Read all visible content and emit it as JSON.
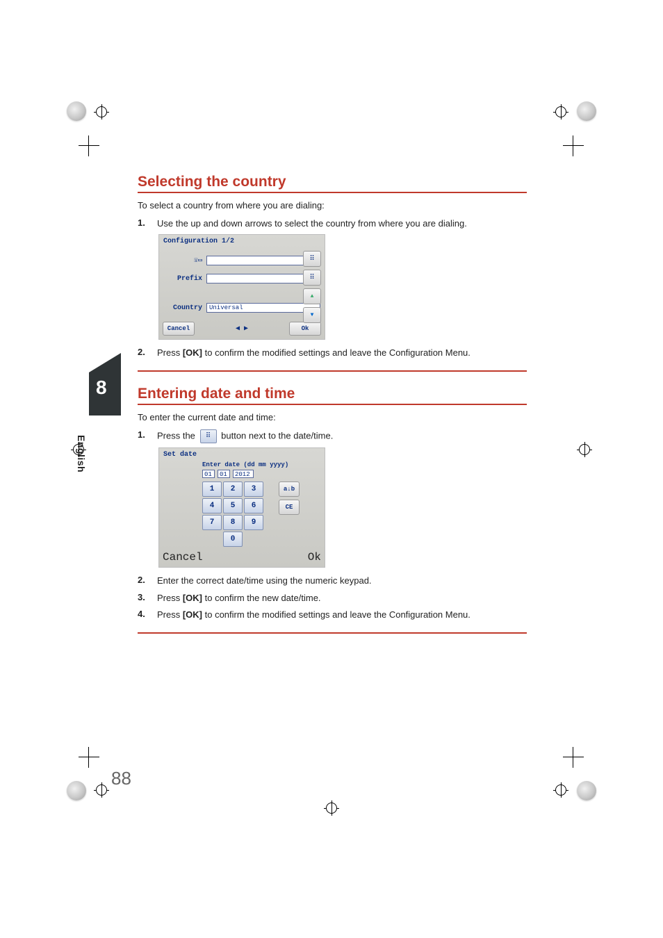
{
  "page_number": "88",
  "chapter_number": "8",
  "language_tab": "English",
  "section1": {
    "title": "Selecting the country",
    "intro": "To select a country from where you are dialing:",
    "steps": [
      {
        "num": "1.",
        "text": "Use the up and down arrows to select the country from where you are dialing."
      },
      {
        "num": "2.",
        "pre": "Press ",
        "bold": "[OK]",
        "post": " to confirm the modified settings and leave the Configuration Menu."
      }
    ]
  },
  "mock1": {
    "title": "Configuration 1/2",
    "prefix_label": "Prefix",
    "prefix_value": "",
    "country_label": "Country",
    "country_value": "Universal",
    "side_icon": "⠿",
    "up": "▲",
    "down": "▼",
    "cancel": "Cancel",
    "nav": "◀ ▶",
    "ok": "Ok"
  },
  "section2": {
    "title": "Entering date and time",
    "intro": "To enter the current date and time:",
    "steps": [
      {
        "num": "1.",
        "pre": "Press the ",
        "post": " button next to the date/time."
      },
      {
        "num": "2.",
        "text": "Enter the correct date/time using the numeric keypad."
      },
      {
        "num": "3.",
        "pre": "Press ",
        "bold": "[OK]",
        "post": " to confirm the new date/time."
      },
      {
        "num": "4.",
        "pre": "Press ",
        "bold": "[OK]",
        "post": " to confirm the modified settings and leave the Configuration Menu."
      }
    ],
    "inline_icon": "⠿"
  },
  "mock2": {
    "title": "Set date",
    "hint": "Enter date (dd mm yyyy)",
    "dd": "01",
    "mm": "01",
    "yyyy": "2012",
    "keys": [
      "1",
      "2",
      "3",
      "4",
      "5",
      "6",
      "7",
      "8",
      "9",
      "0"
    ],
    "side_abc": "a↓b",
    "side_ce": "CE",
    "cancel": "Cancel",
    "ok": "Ok"
  }
}
